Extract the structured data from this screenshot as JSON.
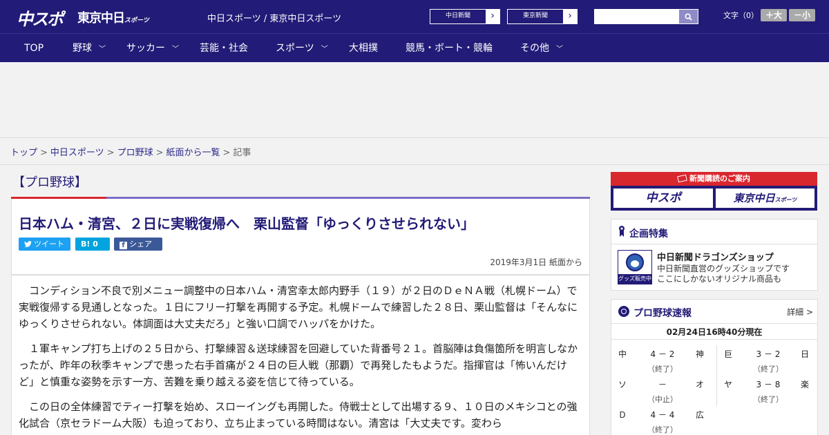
{
  "header": {
    "logo_main": "中スポ",
    "logo_tokyo": "東京中日",
    "logo_tokyo_sub": "スポーツ",
    "site_subtitle": "中日スポーツ / 東京中日スポーツ",
    "paper_links": [
      {
        "label": "中日新聞",
        "arrow": "›"
      },
      {
        "label": "東京新聞",
        "arrow": "›"
      }
    ],
    "search_value": "",
    "font_size_label": "文字（0）",
    "font_larger": "＋大",
    "font_smaller": "－小"
  },
  "nav": {
    "items": [
      {
        "label": "TOP"
      },
      {
        "label": "野球",
        "chevron": "﹀"
      },
      {
        "label": "サッカー",
        "chevron": "﹀"
      },
      {
        "label": "芸能・社会"
      },
      {
        "label": "スポーツ",
        "chevron": "﹀"
      },
      {
        "label": "大相撲"
      },
      {
        "label": "競馬・ボート・競輪"
      },
      {
        "label": "その他",
        "chevron": "﹀"
      }
    ]
  },
  "breadcrumb": {
    "items": [
      "トップ",
      "中日スポーツ",
      "プロ野球",
      "紙面から一覧"
    ],
    "current": "記事",
    "separator": ">"
  },
  "article": {
    "category": "【プロ野球】",
    "title": "日本ハム・清宮、２日に実戦復帰へ　栗山監督「ゆっくりさせられない」",
    "share": {
      "tweet": "ツイート",
      "hatena": "B! 0",
      "facebook": "シェア 0"
    },
    "date": "2019年3月1日 紙面から",
    "paragraphs": [
      "コンディション不良で別メニュー調整中の日本ハム・清宮幸太郎内野手（１９）が２日のＤｅＮＡ戦（札幌ドーム）で実戦復帰する見通しとなった。１日にフリー打撃を再開する予定。札幌ドームで練習した２８日、栗山監督は「そんなにゆっくりさせられない。体調面は大丈夫だろ」と強い口調でハッパをかけた。",
      "１軍キャンプ打ち上げの２５日から、打撃練習＆送球練習を回避していた背番号２１。首脳陣は負傷箇所を明言しなかったが、昨年の秋季キャンプで患った右手首痛が２４日の巨人戦（那覇）で再発したもようだ。指揮官は「怖いんだけど」と慎重な姿勢を示す一方、苦難を乗り越える姿を信じて待っている。",
      "この日の全体練習でティー打撃を始め、スローイングも再開した。侍戦士として出場する９、１０日のメキシコとの強化試合（京セラドーム大阪）も迫っており、立ち止まっている時間はない。清宮は「大丈夫です。変わら"
    ]
  },
  "sidebar": {
    "subscribe": {
      "header": "新聞購読のご案内",
      "logo_chuspo": "中スポ",
      "logo_tokyo": "東京中日",
      "logo_tokyo_sub": "スポーツ"
    },
    "feature": {
      "heading": "企画特集",
      "image_tag": "グッズ販売中",
      "name": "中日新聞ドラゴンズショップ",
      "desc_line1": "中日新聞直営のグッズショップです",
      "desc_line2": "ここにしかないオリジナル商品も"
    },
    "scores": {
      "heading": "プロ野球速報",
      "more": "詳細 >",
      "updated": "02月24日16時40分現在",
      "left": [
        {
          "team1": "中",
          "score": "4 － 2",
          "status": "（終了）",
          "team2": "神"
        },
        {
          "team1": "ソ",
          "score": "－",
          "status": "（中止）",
          "team2": "オ"
        },
        {
          "team1": "Ｄ",
          "score": "4 － 4",
          "status": "（終了）",
          "team2": "広"
        }
      ],
      "right": [
        {
          "team1": "巨",
          "score": "3 － 2",
          "status": "（終了）",
          "team2": "日"
        },
        {
          "team1": "ヤ",
          "score": "3 － 8",
          "status": "（終了）",
          "team2": "楽"
        }
      ]
    }
  },
  "colors": {
    "brand_navy": "#221b77",
    "accent_red": "#d9272e",
    "twitter": "#1da1f2",
    "hatena": "#00a4de",
    "facebook": "#3b5998"
  }
}
